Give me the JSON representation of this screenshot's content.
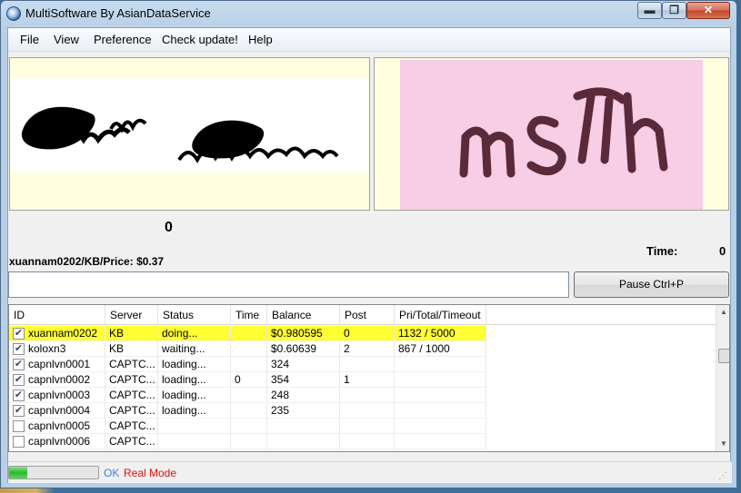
{
  "window": {
    "title": "MultiSoftware By AsianDataService",
    "controls": {
      "minimize": "▬",
      "maximize": "❐",
      "close": "✕"
    }
  },
  "menu": [
    "File",
    "View",
    "Preference",
    "Check update!",
    "Help"
  ],
  "captcha": {
    "left_text": "",
    "right_text": "msm",
    "counter": "0"
  },
  "info": {
    "time_label": "Time:",
    "time_value": "0",
    "price_label": "xuannam0202/KB/Price:  $0.37"
  },
  "input": {
    "value": "",
    "placeholder": ""
  },
  "pause_button": "Pause   Ctrl+P",
  "grid": {
    "columns": [
      "ID",
      "Server",
      "Status",
      "Time",
      "Balance",
      "Post",
      "Pri/Total/Timeout"
    ],
    "rows": [
      {
        "checked": true,
        "highlight": true,
        "id": "xuannam0202",
        "server": "KB",
        "status": "doing...",
        "time": "",
        "balance": "$0.980595",
        "post": "0",
        "pri": "1132 / 5000"
      },
      {
        "checked": true,
        "highlight": false,
        "id": "koloxn3",
        "server": "KB",
        "status": "waiting...",
        "time": "",
        "balance": "$0.60639",
        "post": "2",
        "pri": "867 / 1000"
      },
      {
        "checked": true,
        "highlight": false,
        "id": "capnlvn0001",
        "server": "CAPTC...",
        "status": "loading...",
        "time": "",
        "balance": "324",
        "post": "",
        "pri": ""
      },
      {
        "checked": true,
        "highlight": false,
        "id": "capnlvn0002",
        "server": "CAPTC...",
        "status": "loading...",
        "time": "0",
        "balance": "354",
        "post": "1",
        "pri": ""
      },
      {
        "checked": true,
        "highlight": false,
        "id": "capnlvn0003",
        "server": "CAPTC...",
        "status": "loading...",
        "time": "",
        "balance": "248",
        "post": "",
        "pri": ""
      },
      {
        "checked": true,
        "highlight": false,
        "id": "capnlvn0004",
        "server": "CAPTC...",
        "status": "loading...",
        "time": "",
        "balance": "235",
        "post": "",
        "pri": ""
      },
      {
        "checked": false,
        "highlight": false,
        "id": "capnlvn0005",
        "server": "CAPTC...",
        "status": "",
        "time": "",
        "balance": "",
        "post": "",
        "pri": ""
      },
      {
        "checked": false,
        "highlight": false,
        "id": "capnlvn0006",
        "server": "CAPTC...",
        "status": "",
        "time": "",
        "balance": "",
        "post": "",
        "pri": ""
      }
    ]
  },
  "status": {
    "progress_fraction": 0.2,
    "ok": "OK",
    "mode": "Real Mode"
  },
  "icons": {
    "app": "app-globe-icon",
    "check": "checkmark-icon",
    "scroll_up": "scroll-up-arrow-icon",
    "scroll_down": "scroll-down-arrow-icon",
    "grip": "resize-grip-icon"
  },
  "colors": {
    "highlight_row": "#ffff33",
    "status_ok": "#3f7fd0",
    "status_mode": "#e01010",
    "captcha_right_bg": "#f8cde6",
    "captcha_panel_bg": "#ffffe0"
  }
}
